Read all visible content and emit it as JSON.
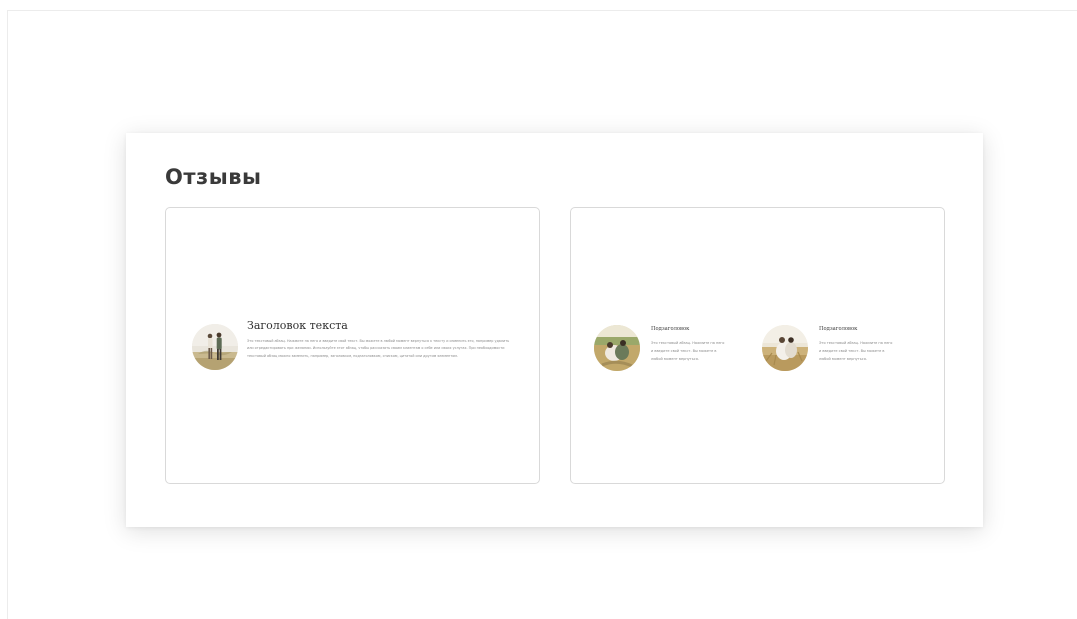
{
  "section": {
    "title": "Отзывы"
  },
  "card_single": {
    "avatar_icon": "couple-field-photo",
    "title": "Заголовок текста",
    "text": "Это текстовый абзац. Нажмите на него и введите свой текст. Вы можете в любой момент вернуться к тексту и изменить его, например удалить или отредактировать при желании. Используйте этот абзац, чтобы рассказать своим клиентам о себе или своих услугах. При необходимости текстовый абзац можно заменить, например, заголовком, подзаголовком, списком, цитатой или другим элементом."
  },
  "card_double": {
    "items": [
      {
        "avatar_icon": "couple-field-photo",
        "subtitle": "Подзаголовок",
        "text": "Это текстовый абзац. Нажмите на него и введите свой текст. Вы можете в любой момент вернуться."
      },
      {
        "avatar_icon": "couple-wheat-photo",
        "subtitle": "Подзаголовок",
        "text": "Это текстовый абзац. Нажмите на него и введите свой текст. Вы можете в любой момент вернуться."
      }
    ]
  },
  "colors": {
    "title": "#3a3a3a",
    "card_border": "#d9d9d9",
    "body_text": "#8a8a8a"
  }
}
